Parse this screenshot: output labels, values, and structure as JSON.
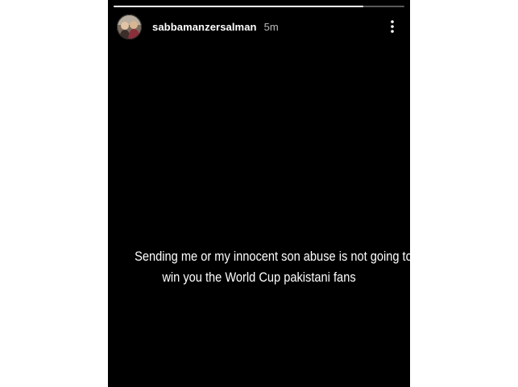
{
  "story": {
    "username": "sabbamanzersalman",
    "time_ago": "5m",
    "progress": 0.86,
    "caption_lines": [
      "Sending me or my innocent son abuse is not going to",
      "win you the World Cup pakistani fans"
    ]
  },
  "icons": {
    "avatar": "profile-photo",
    "more": "more-vertical-icon"
  },
  "colors": {
    "background": "#ffffff",
    "story_background": "#000000",
    "text": "#ffffff"
  }
}
